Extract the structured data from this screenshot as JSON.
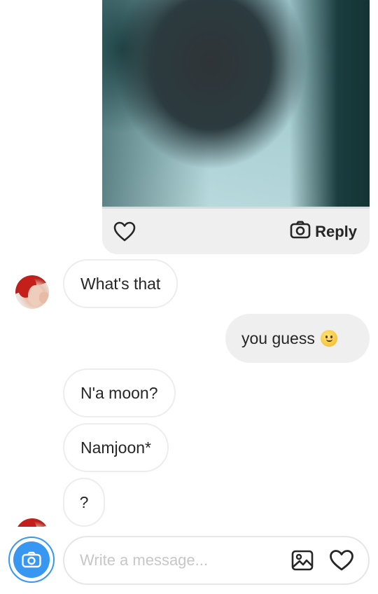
{
  "shared_media": {
    "reply_label": "Reply",
    "icons": {
      "like": "heart-outline-icon",
      "reply": "camera-icon"
    }
  },
  "messages": [
    {
      "id": "m1",
      "direction": "incoming",
      "text": "What's that",
      "show_avatar": true
    },
    {
      "id": "m2",
      "direction": "outgoing",
      "text": "you guess",
      "emoji": "slightly-smiling-face"
    },
    {
      "id": "m3",
      "direction": "incoming",
      "text": "N'a moon?",
      "show_avatar": false
    },
    {
      "id": "m4",
      "direction": "incoming",
      "text": "Namjoon*",
      "show_avatar": false
    },
    {
      "id": "m5",
      "direction": "incoming",
      "text": "?",
      "show_avatar": true
    }
  ],
  "composer": {
    "placeholder": "Write a message...",
    "value": "",
    "icons": {
      "camera": "camera-icon",
      "gallery": "image-icon",
      "like": "heart-outline-icon"
    }
  },
  "colors": {
    "accent": "#3897f0",
    "outgoing_bubble": "#efefef",
    "incoming_border": "#ededed",
    "text": "#262626",
    "placeholder": "#c7c7c7"
  }
}
